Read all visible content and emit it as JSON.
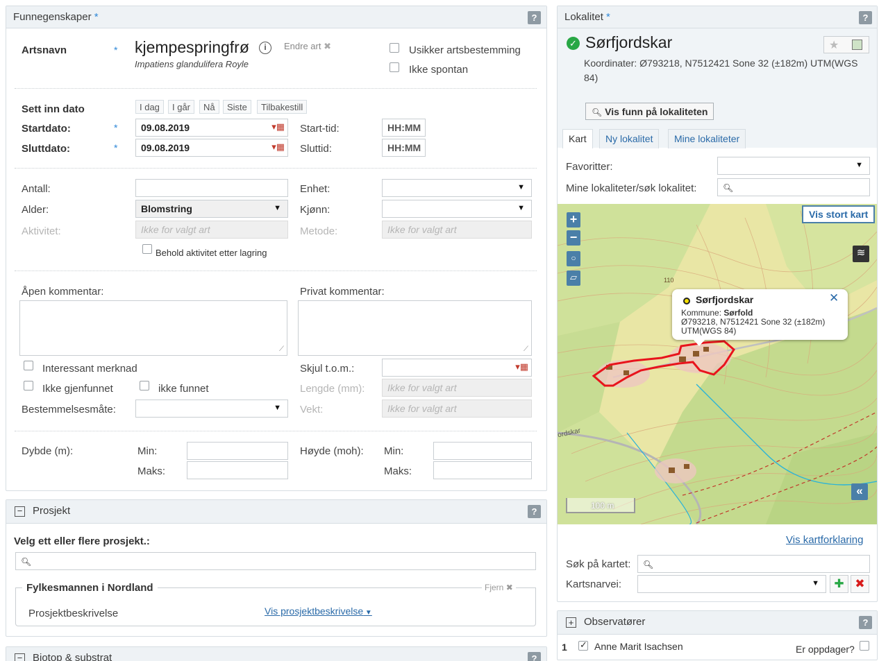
{
  "funn": {
    "header": "Funnegenskaper",
    "help": "?",
    "artsnavn_label": "Artsnavn",
    "species_name": "kjempespringfrø",
    "species_latin": "Impatiens glandulifera Royle",
    "endre_art": "Endre art",
    "usikker": "Usikker artsbestemming",
    "ikke_spontan": "Ikke spontan",
    "sett_inn_dato": "Sett inn dato",
    "date_buttons": [
      "I dag",
      "I går",
      "Nå",
      "Siste",
      "Tilbakestill"
    ],
    "startdato_label": "Startdato:",
    "sluttdato_label": "Sluttdato:",
    "startdato": "09.08.2019",
    "sluttdato": "09.08.2019",
    "starttid_label": "Start-tid:",
    "sluttid_label": "Sluttid:",
    "time_placeholder": "HH:MM",
    "antall_label": "Antall:",
    "enhet_label": "Enhet:",
    "alder_label": "Alder:",
    "alder_value": "Blomstring",
    "kjonn_label": "Kjønn:",
    "aktivitet_label": "Aktivitet:",
    "metode_label": "Metode:",
    "ikke_for_valgt_art": "Ikke for valgt art",
    "behold_aktivitet": "Behold aktivitet etter lagring",
    "apen_kommentar": "Åpen kommentar:",
    "privat_kommentar": "Privat kommentar:",
    "interessant": "Interessant merknad",
    "ikke_gjenfunnet": "Ikke gjenfunnet",
    "ikke_funnet": "ikke funnet",
    "bestemmelsesmate": "Bestemmelsesmåte:",
    "skjul": "Skjul t.o.m.:",
    "lengde": "Lengde (mm):",
    "vekt": "Vekt:",
    "dybde": "Dybde (m):",
    "hoyde": "Høyde (moh):",
    "min": "Min:",
    "maks": "Maks:"
  },
  "prosjekt": {
    "header": "Prosjekt",
    "velg": "Velg ett eller flere prosjekt.:",
    "group_title": "Fylkesmannen i Nordland",
    "fjern": "Fjern",
    "beskrivelse_label": "Prosjektbeskrivelse",
    "vis_beskrivelse": "Vis prosjektbeskrivelse"
  },
  "biotop": {
    "header": "Biotop & substrat"
  },
  "lokalitet": {
    "header": "Lokalitet",
    "name": "Sørfjordskar",
    "koordinater": "Koordinater: Ø793218, N7512421 Sone 32 (±182m) UTM(WGS",
    "koordinater2": "84)",
    "vis_funn": "Vis funn på lokaliteten",
    "tabs": [
      "Kart",
      "Ny lokalitet",
      "Mine lokaliteter"
    ],
    "favoritter": "Favoritter:",
    "mine_lok": "Mine lokaliteter/søk lokalitet:",
    "vis_stort_kart": "Vis stort kart",
    "popup_title": "Sørfjordskar",
    "popup_kommune_label": "Kommune:",
    "popup_kommune": "Sørfold",
    "popup_coords": "Ø793218, N7512421 Sone 32 (±182m)",
    "popup_coords2": "UTM(WGS 84)",
    "scale": "100 m",
    "map_label_110": "110",
    "map_label_place": "ordskar",
    "vis_kartforklaring": "Vis kartforklaring",
    "sok_kartet": "Søk på kartet:",
    "kartsnarvei": "Kartsnarvei:"
  },
  "observatorer": {
    "header": "Observatører",
    "row_num": "1",
    "name": "Anne Marit Isachsen",
    "er_oppdager": "Er oppdager?"
  },
  "colors": {
    "accent": "#2f88d8",
    "link": "#2a6aa8",
    "map_boundary": "#e8141c",
    "header_bg": "#eef2f5"
  }
}
